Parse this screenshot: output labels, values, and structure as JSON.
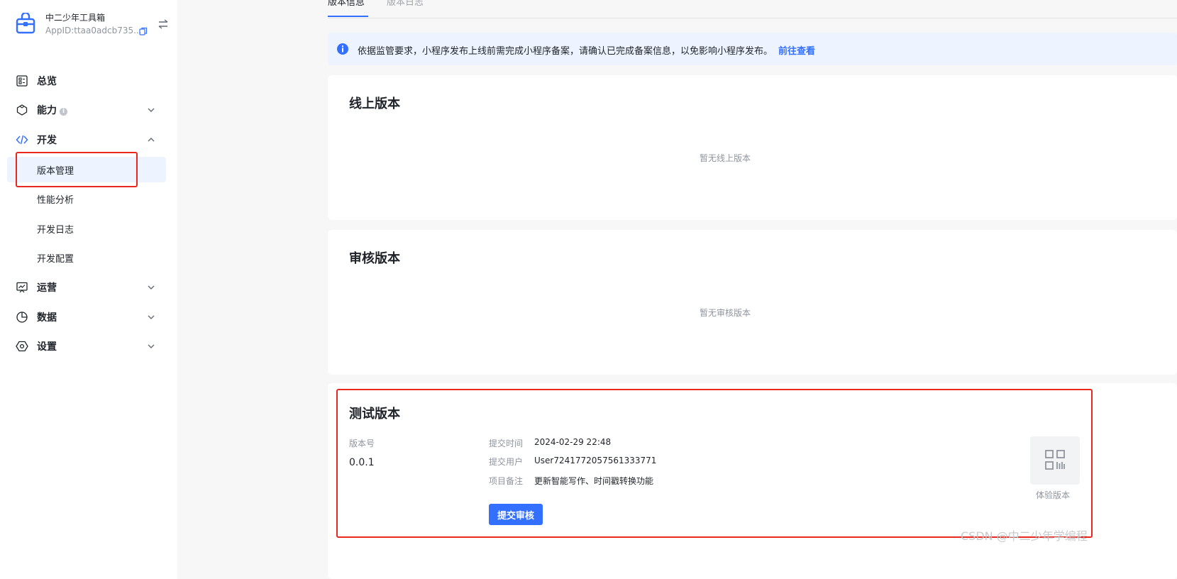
{
  "app": {
    "name": "中二少年工具箱",
    "app_id": "AppID:ttaa0adcb735..."
  },
  "sidebar": {
    "items": [
      {
        "label": "总览",
        "icon": "dashboard-icon"
      },
      {
        "label": "能力",
        "icon": "capability-icon",
        "info": "i"
      },
      {
        "label": "开发",
        "icon": "code-icon"
      },
      {
        "label": "运营",
        "icon": "operation-chart-icon"
      },
      {
        "label": "数据",
        "icon": "pie-chart-icon"
      },
      {
        "label": "设置",
        "icon": "settings-hex-icon"
      }
    ],
    "dev_sub": [
      {
        "label": "版本管理",
        "active": true
      },
      {
        "label": "性能分析"
      },
      {
        "label": "开发日志"
      },
      {
        "label": "开发配置"
      }
    ]
  },
  "tabs": [
    {
      "label": "版本信息",
      "active": true
    },
    {
      "label": "版本日志",
      "active": false
    }
  ],
  "notice": {
    "text": "依据监管要求，小程序发布上线前需完成小程序备案，请确认已完成备案信息，以免影响小程序发布。",
    "link": "前往查看"
  },
  "online": {
    "title": "线上版本",
    "empty": "暂无线上版本"
  },
  "review": {
    "title": "审核版本",
    "empty": "暂无审核版本"
  },
  "test": {
    "title": "测试版本",
    "version_label": "版本号",
    "version_value": "0.0.1",
    "submit_time_label": "提交时间",
    "submit_time": "2024-02-29 22:48",
    "submit_user_label": "提交用户",
    "submit_user": "User7241772057561333771",
    "note_label": "项目备注",
    "note": "更新智能写作、时间戳转换功能",
    "submit_button": "提交审核",
    "preview_label": "体验版本"
  },
  "watermark": "CSDN @中二少年学编程",
  "colors": {
    "accent": "#3370ff",
    "highlight_border": "#e8281e",
    "notice_bg": "#eef4ff"
  }
}
